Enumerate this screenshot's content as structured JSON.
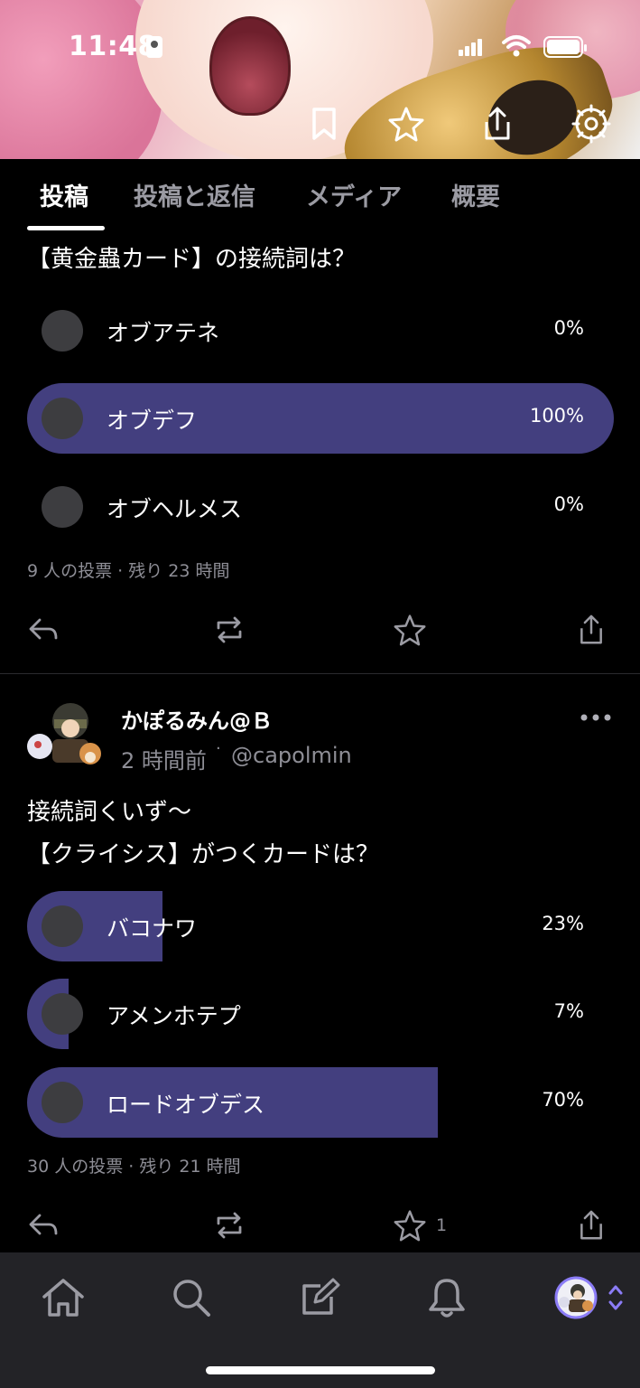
{
  "status_bar": {
    "time": "11:48"
  },
  "tabs": [
    {
      "label": "投稿"
    },
    {
      "label": "投稿と返信"
    },
    {
      "label": "メディア"
    },
    {
      "label": "概要"
    }
  ],
  "post1": {
    "question": "【黄金蟲カード】の接続詞は？",
    "options": [
      {
        "label": "オブアテネ",
        "percent_text": "0%",
        "percent": 0
      },
      {
        "label": "オブデフ",
        "percent_text": "100%",
        "percent": 100
      },
      {
        "label": "オブヘルメス",
        "percent_text": "0%",
        "percent": 0
      }
    ],
    "meta": "9 人の投票 · 残り 23 時間"
  },
  "post2": {
    "display_name": "かぽるみん@Ｂ",
    "time_ago": "2 時間前",
    "handle": "@capolmin",
    "text_line1": "接続詞くいず〜",
    "text_line2": "【クライシス】がつくカードは？",
    "options": [
      {
        "label": "バコナワ",
        "percent_text": "23%",
        "percent": 23
      },
      {
        "label": "アメンホテプ",
        "percent_text": "7%",
        "percent": 7
      },
      {
        "label": "ロードオブデス",
        "percent_text": "70%",
        "percent": 70
      }
    ],
    "meta": "30 人の投票 · 残り 21 時間",
    "like_count": "1"
  },
  "colors": {
    "poll_fill": "#433f7f",
    "accent": "#8b7cf6"
  }
}
